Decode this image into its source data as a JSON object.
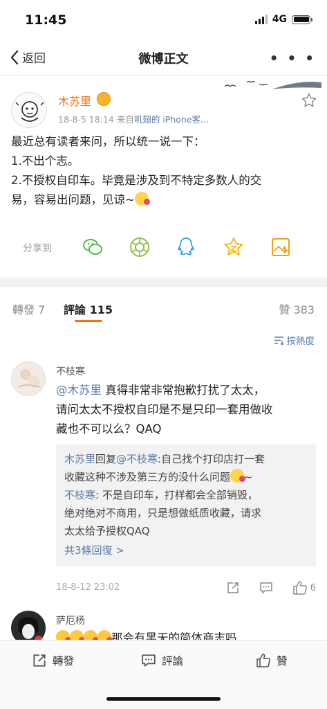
{
  "status": {
    "time": "11:45",
    "network": "4G"
  },
  "nav": {
    "back_label": "返回",
    "title": "微博正文",
    "more_label": "• • •"
  },
  "post": {
    "author": "木苏里",
    "meta_time": "18-8-5 18:14",
    "meta_from": "来自",
    "meta_source": "叽翅的 iPhone客...",
    "lines": [
      "最近总有读者来问，所以统一说一下：",
      "1.不出个志。",
      "2.不授权自印车。毕竟是涉及到不特定多数人的交",
      "易，容易出问题，见谅~"
    ],
    "share_label": "分享到",
    "share_icons": [
      "wechat-icon",
      "moments-icon",
      "qq-icon",
      "qzone-icon",
      "save-image-icon"
    ]
  },
  "tabs": {
    "reposts": "轉發 7",
    "comments": "評論 115",
    "likes": "贊 383"
  },
  "sort_label": "按熱度",
  "comments": [
    {
      "name": "不枝寒",
      "mention": "@木苏里",
      "text_l1_rest": " 真得非常非常抱歉打扰了太太，",
      "text_l2": "请问太太不授权自印是不是只印一套用做收",
      "text_l3": "藏也不可以么？QAQ",
      "replies": [
        {
          "from": "木苏里",
          "verb": "回复",
          "to": "@不枝寒",
          "l1": ":自己找个打印店打一套",
          "l2": "收藏这种不涉及第三方的没什么问题",
          "l2_tail": "~"
        },
        {
          "from": "不枝寒",
          "l1": ": 不是自印车，打样都会全部销毁，",
          "l2": "绝对绝对不商用，只是想做纸质收藏，请求",
          "l3": "太太给予授权QAQ"
        }
      ],
      "more_replies": "共3條回復 >",
      "time": "18-8-12 23:02",
      "like_count": "6"
    },
    {
      "name": "萨厄杨",
      "text": "那会有黑天的简体商志吗"
    }
  ],
  "bottom": {
    "repost": "轉發",
    "comment": "評論",
    "like": "贊"
  }
}
